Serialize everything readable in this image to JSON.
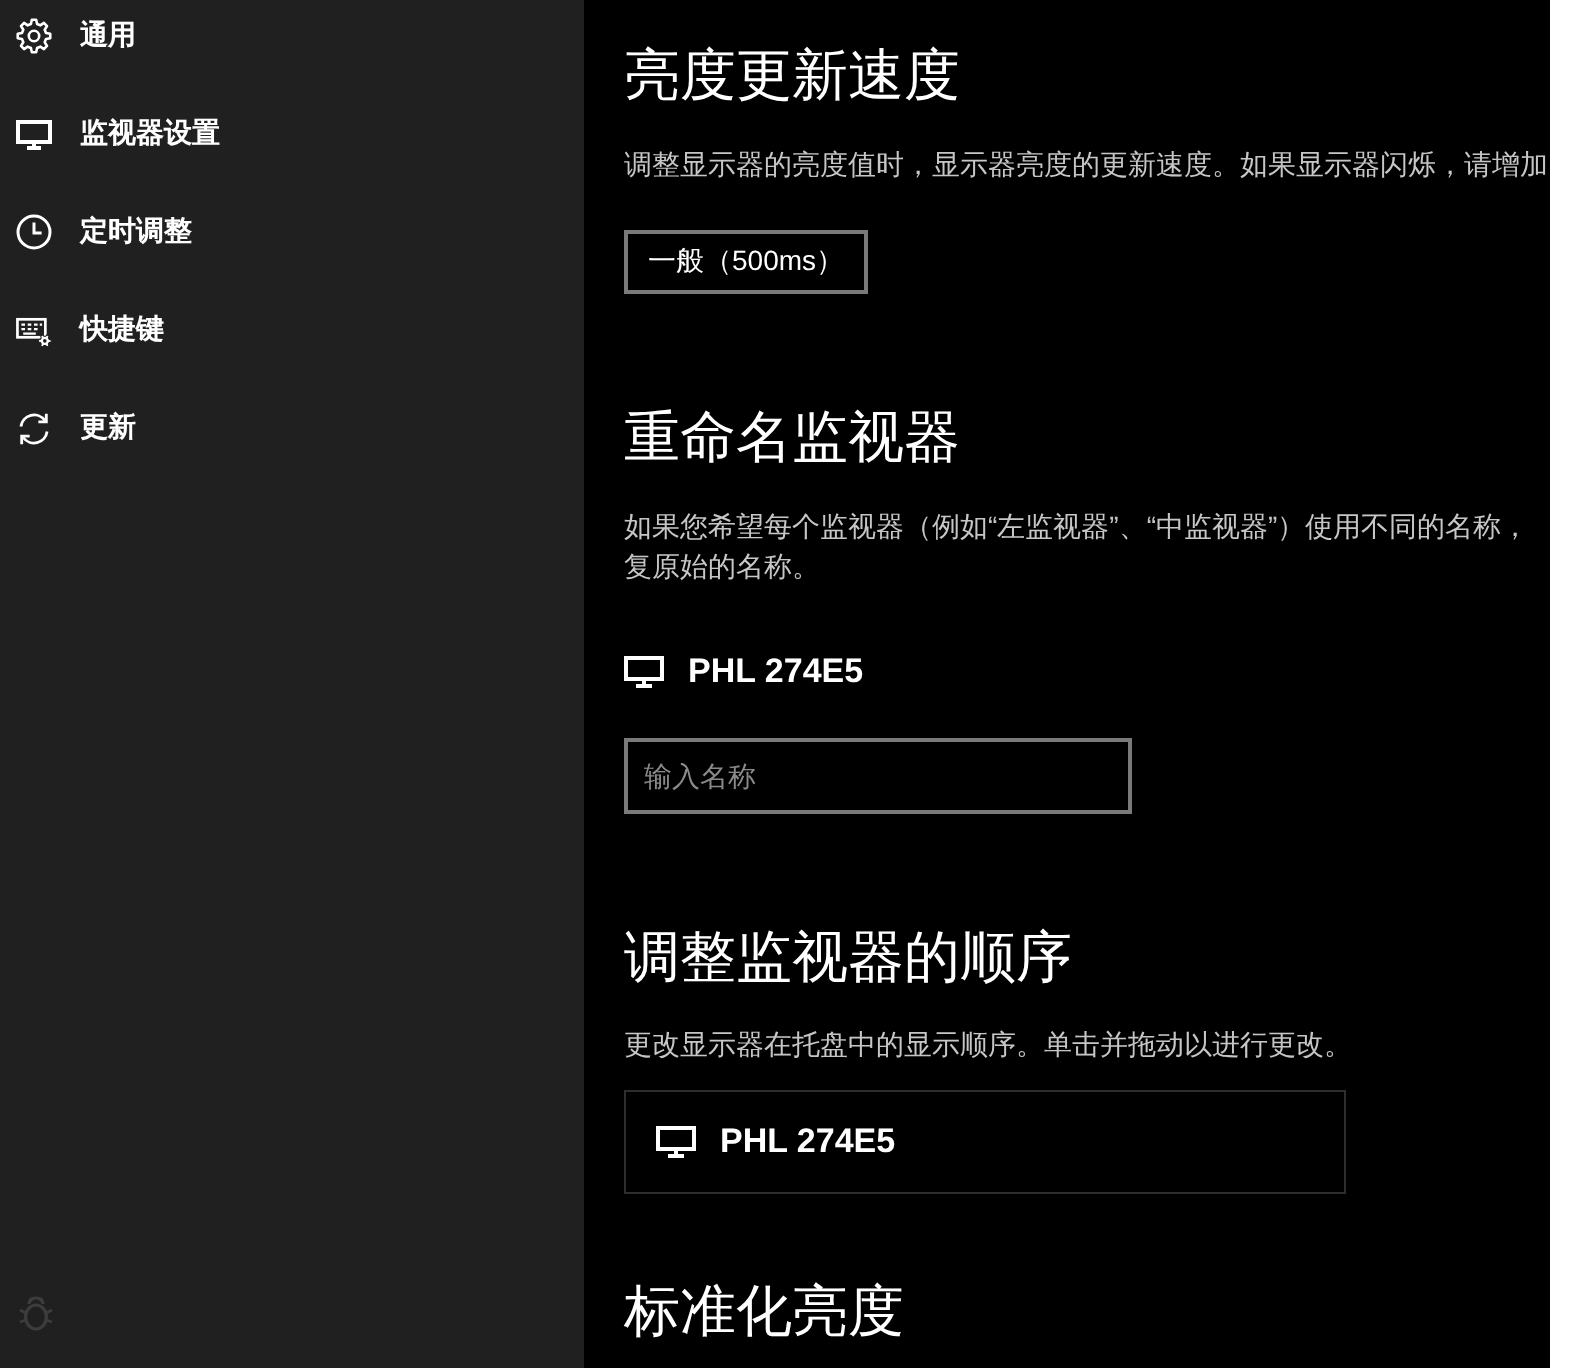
{
  "sidebar": {
    "items": [
      {
        "label": "通用"
      },
      {
        "label": "监视器设置"
      },
      {
        "label": "定时调整"
      },
      {
        "label": "快捷键"
      },
      {
        "label": "更新"
      }
    ]
  },
  "sections": [
    {
      "kind": "speed",
      "title": "亮度更新速度",
      "description": [
        "调整显示器的亮度值时，显示器亮度的更新速度。如果显示器闪烁，请增加"
      ],
      "button": "一般（500ms）"
    },
    {
      "kind": "rename",
      "title": "重命名监视器",
      "description": [
        "如果您希望每个监视器（例如“左监视器”、“中监视器”）使用不同的名称，",
        "复原始的名称。"
      ],
      "monitor": "PHL 274E5",
      "input": {
        "placeholder": "输入名称"
      }
    },
    {
      "kind": "order",
      "title": "调整监视器的顺序",
      "description": [
        "更改显示器在托盘中的显示顺序。单击并拖动以进行更改。"
      ],
      "monitors": [
        "PHL 274E5"
      ]
    },
    {
      "kind": "heading",
      "title": "标准化亮度"
    }
  ]
}
